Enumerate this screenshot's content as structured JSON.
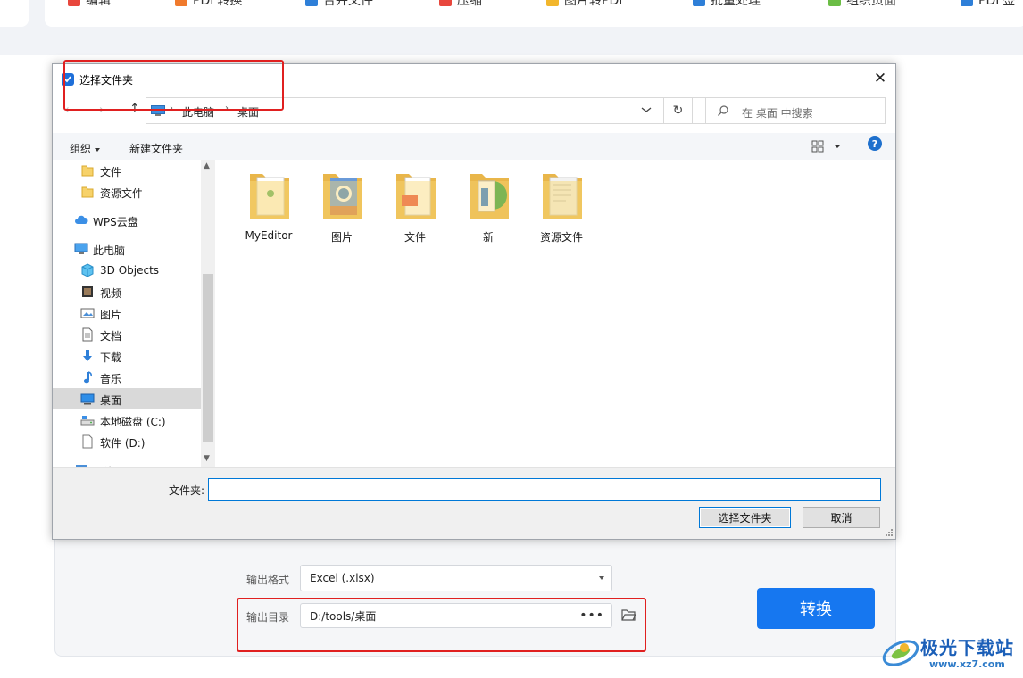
{
  "app": {
    "toolbar": [
      {
        "label": "编辑",
        "icon": "edit-icon",
        "color": "#e8473d"
      },
      {
        "label": "PDF转换",
        "icon": "pdf-convert-icon",
        "color": "#f07a2c"
      },
      {
        "label": "合并文件",
        "icon": "merge-icon",
        "color": "#2e7fd8"
      },
      {
        "label": "压缩",
        "icon": "compress-icon",
        "color": "#e8473d"
      },
      {
        "label": "图片转PDF",
        "icon": "image-to-pdf-icon",
        "color": "#f2b62c"
      },
      {
        "label": "批量处理",
        "icon": "batch-icon",
        "color": "#2e7fd8"
      },
      {
        "label": "组织页面",
        "icon": "organize-pages-icon",
        "color": "#6bbd45"
      },
      {
        "label": "PDF签",
        "icon": "sign-icon",
        "color": "#2e7fd8"
      }
    ],
    "output_format": {
      "label": "输出格式",
      "value": "Excel (.xlsx)"
    },
    "output_dir": {
      "label": "输出目录",
      "value": "D:/tools/桌面",
      "more": "•••"
    },
    "convert_button": "转换",
    "accent_color": "#1677f0",
    "highlight_color": "#e02020"
  },
  "dialog": {
    "title": "选择文件夹",
    "close_glyph": "✕",
    "breadcrumb": [
      "此电脑",
      "桌面"
    ],
    "search_placeholder": "在 桌面 中搜索",
    "commands": {
      "organize": "组织",
      "new_folder": "新建文件夹"
    },
    "help": "?",
    "nav_items": [
      {
        "label": "文件",
        "icon": "folder-icon"
      },
      {
        "label": "资源文件",
        "icon": "folder-icon"
      },
      {
        "label": "WPS云盘",
        "icon": "cloud-icon"
      },
      {
        "label": "此电脑",
        "icon": "this-pc-icon"
      },
      {
        "label": "3D Objects",
        "icon": "3d-objects-icon"
      },
      {
        "label": "视频",
        "icon": "video-icon"
      },
      {
        "label": "图片",
        "icon": "pictures-icon"
      },
      {
        "label": "文档",
        "icon": "documents-icon"
      },
      {
        "label": "下载",
        "icon": "download-icon"
      },
      {
        "label": "音乐",
        "icon": "music-icon"
      },
      {
        "label": "桌面",
        "icon": "desktop-icon",
        "selected": true
      },
      {
        "label": "本地磁盘 (C:)",
        "icon": "local-disk-icon"
      },
      {
        "label": "软件 (D:)",
        "icon": "drive-icon"
      },
      {
        "label": "网络",
        "icon": "network-icon"
      }
    ],
    "folders": [
      {
        "name": "MyEditor"
      },
      {
        "name": "图片"
      },
      {
        "name": "文件"
      },
      {
        "name": "新"
      },
      {
        "name": "资源文件"
      }
    ],
    "folder_field_label": "文件夹:",
    "folder_field_value": "",
    "select_button": "选择文件夹",
    "cancel_button": "取消"
  },
  "watermark": {
    "text": "极光下载站",
    "url": "www.xz7.com"
  }
}
